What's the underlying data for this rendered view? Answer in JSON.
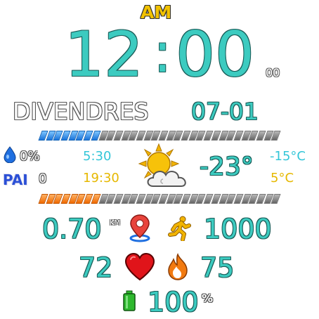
{
  "time": {
    "ampm": "AM",
    "hour": "12",
    "separator": ":",
    "minute": "00",
    "seconds": "00"
  },
  "date": {
    "weekday": "DIVENDRES",
    "date": "07-01"
  },
  "progress": {
    "top_bar_fraction": 0.25,
    "bottom_bar_fraction": 0.25,
    "top_color": "#1a73d9",
    "bottom_color": "#f06a00"
  },
  "health": {
    "humidity": "0%",
    "pai_label": "PAI",
    "pai_value": "0"
  },
  "sun": {
    "sunrise": "5:30",
    "sunset": "19:30"
  },
  "weather": {
    "icon": "partly-cloudy-icon",
    "current_temp": "-23°",
    "low": "-15°C",
    "high": "5°C"
  },
  "activity": {
    "distance": "0.70",
    "distance_unit": "KM",
    "steps": "1000",
    "heart_rate": "72",
    "calories": "75"
  },
  "battery": {
    "value": "100",
    "unit": "%"
  },
  "colors": {
    "primary": "#3ccbc0",
    "accent_cyan": "#34c6d8",
    "accent_yellow": "#e6b800",
    "ampm": "#f2c200",
    "pai": "#2a4fd6"
  }
}
